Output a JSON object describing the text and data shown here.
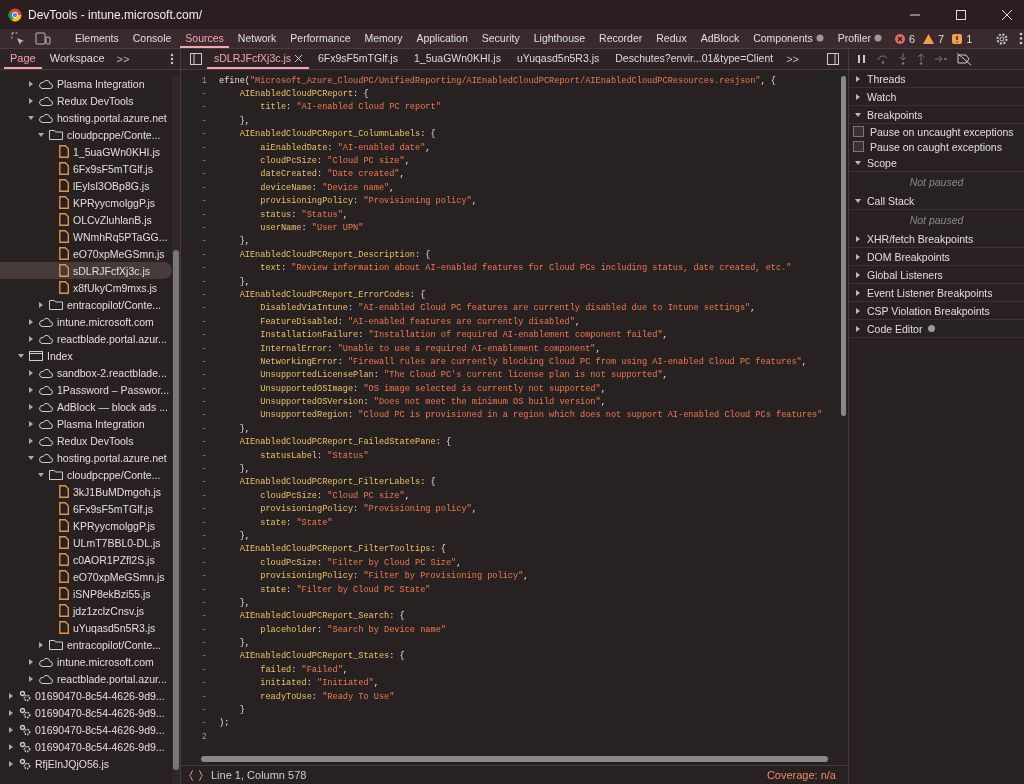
{
  "window": {
    "title": "DevTools - intune.microsoft.com/"
  },
  "main_tabs": [
    {
      "label": "Elements",
      "selected": false,
      "react_icon": false
    },
    {
      "label": "Console",
      "selected": false,
      "react_icon": false
    },
    {
      "label": "Sources",
      "selected": true,
      "react_icon": false
    },
    {
      "label": "Network",
      "selected": false,
      "react_icon": false
    },
    {
      "label": "Performance",
      "selected": false,
      "react_icon": false
    },
    {
      "label": "Memory",
      "selected": false,
      "react_icon": false
    },
    {
      "label": "Application",
      "selected": false,
      "react_icon": false
    },
    {
      "label": "Security",
      "selected": false,
      "react_icon": false
    },
    {
      "label": "Lighthouse",
      "selected": false,
      "react_icon": false
    },
    {
      "label": "Recorder",
      "selected": false,
      "react_icon": false
    },
    {
      "label": "Redux",
      "selected": false,
      "react_icon": false
    },
    {
      "label": "AdBlock",
      "selected": false,
      "react_icon": false
    },
    {
      "label": "Components",
      "selected": false,
      "react_icon": true
    },
    {
      "label": "Profiler",
      "selected": false,
      "react_icon": true
    }
  ],
  "counters": {
    "errors": "6",
    "warnings": "7",
    "issues": "1"
  },
  "navigator_tabs": [
    {
      "label": "Page",
      "selected": true
    },
    {
      "label": "Workspace",
      "selected": false
    }
  ],
  "navigator_more": ">>",
  "tree": [
    {
      "children": [
        {
          "children": [
            {
              "label": "Plasma Integration",
              "kind": "cloud",
              "expanded": false,
              "selected": false
            },
            {
              "label": "Redux DevTools",
              "kind": "cloud",
              "expanded": false,
              "selected": false
            },
            {
              "label": "hosting.portal.azure.net",
              "kind": "cloud",
              "expanded": true,
              "selected": false,
              "children": [
                {
                  "label": "cloudpcppe/Conte...",
                  "kind": "folder",
                  "expanded": true,
                  "selected": false,
                  "children": [
                    {
                      "label": "1_5uaGWn0KHI.js",
                      "kind": "file",
                      "selected": false
                    },
                    {
                      "label": "6Fx9sF5mTGlf.js",
                      "kind": "file",
                      "selected": false
                    },
                    {
                      "label": "lEylsI3OBp8G.js",
                      "kind": "file",
                      "selected": false
                    },
                    {
                      "label": "KPRyycmolggP.js",
                      "kind": "file",
                      "selected": false
                    },
                    {
                      "label": "OLCvZluhlanB.js",
                      "kind": "file",
                      "selected": false
                    },
                    {
                      "label": "WNmhRq5PTaGG...",
                      "kind": "file",
                      "selected": false
                    },
                    {
                      "label": "eO70xpMeGSmn.js",
                      "kind": "file",
                      "selected": false
                    },
                    {
                      "label": "sDLRJFcfXj3c.js",
                      "kind": "file",
                      "selected": true
                    },
                    {
                      "label": "x8fUkyCm9mxs.js",
                      "kind": "file",
                      "selected": false
                    }
                  ]
                },
                {
                  "label": "entracopilot/Conte...",
                  "kind": "folder",
                  "expanded": false,
                  "selected": false
                }
              ]
            },
            {
              "label": "intune.microsoft.com",
              "kind": "cloud",
              "expanded": false,
              "selected": false
            },
            {
              "label": "reactblade.portal.azur...",
              "kind": "cloud",
              "expanded": false,
              "selected": false
            }
          ]
        },
        {
          "label": "Index",
          "kind": "frame",
          "expanded": true,
          "selected": false,
          "children": [
            {
              "label": "sandbox-2.reactblade...",
              "kind": "cloud",
              "expanded": false,
              "selected": false
            },
            {
              "label": "1Password – Passwor...",
              "kind": "cloud",
              "expanded": false,
              "selected": false
            },
            {
              "label": "AdBlock — block ads ...",
              "kind": "cloud",
              "expanded": false,
              "selected": false
            },
            {
              "label": "Plasma Integration",
              "kind": "cloud",
              "expanded": false,
              "selected": false
            },
            {
              "label": "Redux DevTools",
              "kind": "cloud",
              "expanded": false,
              "selected": false
            },
            {
              "label": "hosting.portal.azure.net",
              "kind": "cloud",
              "expanded": true,
              "selected": false,
              "children": [
                {
                  "label": "cloudpcppe/Conte...",
                  "kind": "folder",
                  "expanded": true,
                  "selected": false,
                  "children": [
                    {
                      "label": "3kJ1BuMDmgoh.js",
                      "kind": "file",
                      "selected": false
                    },
                    {
                      "label": "6Fx9sF5mTGlf.js",
                      "kind": "file",
                      "selected": false
                    },
                    {
                      "label": "KPRyycmolggP.js",
                      "kind": "file",
                      "selected": false
                    },
                    {
                      "label": "ULmT7BBL0-DL.js",
                      "kind": "file",
                      "selected": false
                    },
                    {
                      "label": "c0AOR1PZfl2S.js",
                      "kind": "file",
                      "selected": false
                    },
                    {
                      "label": "eO70xpMeGSmn.js",
                      "kind": "file",
                      "selected": false
                    },
                    {
                      "label": "iSNP8ekBzi55.js",
                      "kind": "file",
                      "selected": false
                    },
                    {
                      "label": "jdz1zclzCnsv.js",
                      "kind": "file",
                      "selected": false
                    },
                    {
                      "label": "uYuqasd5n5R3.js",
                      "kind": "file",
                      "selected": false
                    }
                  ]
                },
                {
                  "label": "entracopilot/Conte...",
                  "kind": "folder",
                  "expanded": false,
                  "selected": false
                }
              ]
            },
            {
              "label": "intune.microsoft.com",
              "kind": "cloud",
              "expanded": false,
              "selected": false
            },
            {
              "label": "reactblade.portal.azur...",
              "kind": "cloud",
              "expanded": false,
              "selected": false
            }
          ]
        }
      ]
    },
    {
      "label": "01690470-8c54-4626-9d9...",
      "kind": "worker",
      "expanded": false,
      "selected": false
    },
    {
      "label": "01690470-8c54-4626-9d9...",
      "kind": "worker",
      "expanded": false,
      "selected": false
    },
    {
      "label": "01690470-8c54-4626-9d9...",
      "kind": "worker",
      "expanded": false,
      "selected": false
    },
    {
      "label": "01690470-8c54-4626-9d9...",
      "kind": "worker",
      "expanded": false,
      "selected": false
    },
    {
      "label": "RfjElnJQjO56.js",
      "kind": "worker",
      "expanded": false,
      "selected": false
    }
  ],
  "file_tabs": [
    {
      "label": "sDLRJFcfXj3c.js",
      "selected": true
    },
    {
      "label": "6Fx9sF5mTGlf.js",
      "selected": false
    },
    {
      "label": "1_5uaGWn0KHI.js",
      "selected": false
    },
    {
      "label": "uYuqasd5n5R3.js",
      "selected": false
    },
    {
      "label": "Deschutes?envir...01&type=Client",
      "selected": false
    }
  ],
  "file_tabs_more": ">>",
  "code_lines": [
    {
      "n": "1",
      "code": "efine(\"Microsoft_Azure_CloudPC/UnifiedReporting/AIEnabledCloudPCReport/AIEnabledCloudPCResources.resjson\", {"
    },
    {
      "n": "-",
      "code": "    AIEnabledCloudPCReport: {"
    },
    {
      "n": "-",
      "code": "        title: \"AI-enabled Cloud PC report\""
    },
    {
      "n": "-",
      "code": "    },"
    },
    {
      "n": "-",
      "code": "    AIEnabledCloudPCReport_ColumnLabels: {"
    },
    {
      "n": "-",
      "code": "        aiEnabledDate: \"AI-enabled date\","
    },
    {
      "n": "-",
      "code": "        cloudPcSize: \"Cloud PC size\","
    },
    {
      "n": "-",
      "code": "        dateCreated: \"Date created\","
    },
    {
      "n": "-",
      "code": "        deviceName: \"Device name\","
    },
    {
      "n": "-",
      "code": "        provisioningPolicy: \"Provisioning policy\","
    },
    {
      "n": "-",
      "code": "        status: \"Status\","
    },
    {
      "n": "-",
      "code": "        userName: \"User UPN\""
    },
    {
      "n": "-",
      "code": "    },"
    },
    {
      "n": "-",
      "code": "    AIEnabledCloudPCReport_Description: {"
    },
    {
      "n": "-",
      "code": "        text: \"Review information about AI-enabled features for Cloud PCs including status, date created, etc.\""
    },
    {
      "n": "-",
      "code": "    },"
    },
    {
      "n": "-",
      "code": "    AIEnabledCloudPCReport_ErrorCodes: {"
    },
    {
      "n": "-",
      "code": "        DisabledViaIntune: \"AI-enabled Cloud PC features are currently disabled due to Intune settings\","
    },
    {
      "n": "-",
      "code": "        FeatureDisabled: \"AI-enabled features are currently disabled\","
    },
    {
      "n": "-",
      "code": "        InstallationFailure: \"Installation of required AI-enablement component failed\","
    },
    {
      "n": "-",
      "code": "        InternalError: \"Unable to use a required AI-enablement component\","
    },
    {
      "n": "-",
      "code": "        NetworkingError: \"Firewall rules are currently blocking Cloud PC from using AI-enabled Cloud PC features\","
    },
    {
      "n": "-",
      "code": "        UnsupportedLicensePlan: \"The Cloud PC's current license plan is not supported\","
    },
    {
      "n": "-",
      "code": "        UnsupportedOSImage: \"OS image selected is currently not supported\","
    },
    {
      "n": "-",
      "code": "        UnsupportedOSVersion: \"Does not meet the minimum OS build version\","
    },
    {
      "n": "-",
      "code": "        UnsupportedRegion: \"Cloud PC is provisioned in a region which does not support AI-enabled Cloud PCs features\""
    },
    {
      "n": "-",
      "code": "    },"
    },
    {
      "n": "-",
      "code": "    AIEnabledCloudPCReport_FailedStatePane: {"
    },
    {
      "n": "-",
      "code": "        statusLabel: \"Status\""
    },
    {
      "n": "-",
      "code": "    },"
    },
    {
      "n": "-",
      "code": "    AIEnabledCloudPCReport_FilterLabels: {"
    },
    {
      "n": "-",
      "code": "        cloudPcSize: \"Cloud PC size\","
    },
    {
      "n": "-",
      "code": "        provisioningPolicy: \"Provisioning policy\","
    },
    {
      "n": "-",
      "code": "        state: \"State\""
    },
    {
      "n": "-",
      "code": "    },"
    },
    {
      "n": "-",
      "code": "    AIEnabledCloudPCReport_FilterTooltips: {"
    },
    {
      "n": "-",
      "code": "        cloudPcSize: \"Filter by Cloud PC Size\","
    },
    {
      "n": "-",
      "code": "        provisioningPolicy: \"Filter by Provisioning policy\","
    },
    {
      "n": "-",
      "code": "        state: \"Filter by Cloud PC State\""
    },
    {
      "n": "-",
      "code": "    },"
    },
    {
      "n": "-",
      "code": "    AIEnabledCloudPCReport_Search: {"
    },
    {
      "n": "-",
      "code": "        placeholder: \"Search by Device name\""
    },
    {
      "n": "-",
      "code": "    },"
    },
    {
      "n": "-",
      "code": "    AIEnabledCloudPCReport_States: {"
    },
    {
      "n": "-",
      "code": "        failed: \"Failed\","
    },
    {
      "n": "-",
      "code": "        initiated: \"Initiated\","
    },
    {
      "n": "-",
      "code": "        readyToUse: \"Ready To Use\""
    },
    {
      "n": "-",
      "code": "    }"
    },
    {
      "n": "-",
      "code": ");"
    },
    {
      "n": "2"
    }
  ],
  "status_bar": {
    "position": "Line 1, Column 578",
    "coverage": "Coverage: n/a"
  },
  "debugger_panes": [
    {
      "kind": "section",
      "label": "Threads",
      "expanded": false
    },
    {
      "kind": "section",
      "label": "Watch",
      "expanded": false
    },
    {
      "kind": "section",
      "label": "Breakpoints",
      "expanded": true
    },
    {
      "kind": "checkbox",
      "label": "Pause on uncaught exceptions",
      "checked": false
    },
    {
      "kind": "checkbox",
      "label": "Pause on caught exceptions",
      "checked": false
    },
    {
      "kind": "section",
      "label": "Scope",
      "expanded": true
    },
    {
      "kind": "note",
      "label": "Not paused"
    },
    {
      "kind": "section",
      "label": "Call Stack",
      "expanded": true
    },
    {
      "kind": "note",
      "label": "Not paused"
    },
    {
      "kind": "section",
      "label": "XHR/fetch Breakpoints",
      "expanded": false
    },
    {
      "kind": "section",
      "label": "DOM Breakpoints",
      "expanded": false
    },
    {
      "kind": "section",
      "label": "Global Listeners",
      "expanded": false
    },
    {
      "kind": "section",
      "label": "Event Listener Breakpoints",
      "expanded": false
    },
    {
      "kind": "section",
      "label": "CSP Violation Breakpoints",
      "expanded": false
    },
    {
      "kind": "section",
      "label": "Code Editor",
      "expanded": false,
      "dot": true
    }
  ]
}
